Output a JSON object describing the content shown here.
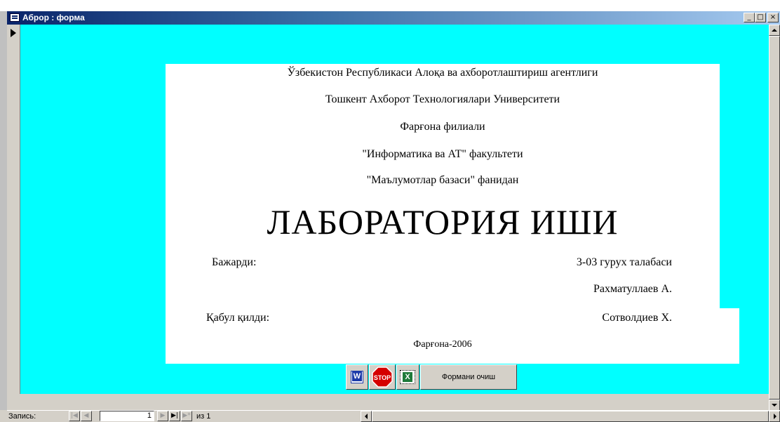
{
  "window": {
    "title": "Аброр : форма",
    "min_glyph": "_",
    "max_glyph": "□",
    "close_glyph": "×"
  },
  "form": {
    "background_color": "#00ffff",
    "lines": [
      "Ўзбекистон Республикаси Алоқа ва ахборотлаштириш агентлиги",
      "Тошкент Ахборот Технологиялари Университети",
      "Фарғона филиали",
      "\"Информатика ва АТ\" факультети",
      "\"Маълумотлар базаси\" фанидан"
    ],
    "main_title": "ЛАБОРАТОРИЯ ИШИ",
    "done_by_label": "Бажарди:",
    "student_group": "3-03 гурух талабаси",
    "student_name": "Рахматуллаев А.",
    "accepted_by_label": "Қабул қилди:",
    "teacher_name": "Сотволдиев Х.",
    "footer": "Фарғона-2006"
  },
  "buttons": {
    "word_icon": "word-icon",
    "stop_icon": "stop-icon",
    "stop_text": "STOP",
    "excel_icon": "excel-icon",
    "close_form_label": "Формани очиш"
  },
  "navigation": {
    "record_label": "Запись:",
    "first_glyph": "|◀",
    "prev_glyph": "◀",
    "current_record": "1",
    "next_glyph": "▶",
    "last_glyph": "▶|",
    "new_glyph": "▶*",
    "of_text": "из 1"
  }
}
